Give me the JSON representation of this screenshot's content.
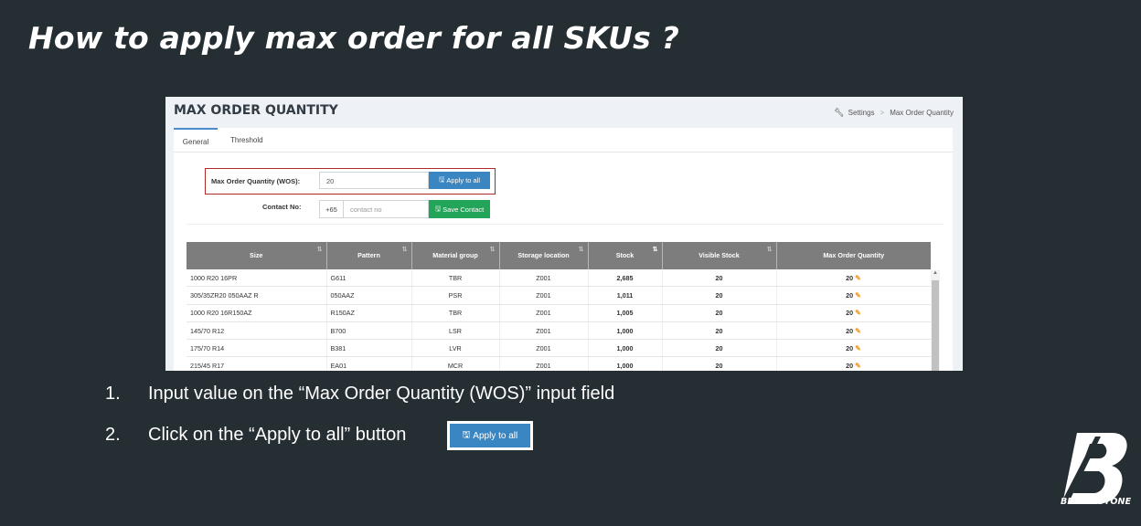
{
  "slide": {
    "title": "How to apply max order for all SKUs ?"
  },
  "screenshot": {
    "page_heading": "MAX ORDER QUANTITY",
    "breadcrumb": {
      "settings": "Settings",
      "current": "Max Order Quantity"
    },
    "tabs": [
      {
        "label": "General",
        "active": true
      },
      {
        "label": "Threshold",
        "active": false
      }
    ],
    "max_order": {
      "label": "Max Order Quantity (WOS):",
      "value": "20",
      "button": "Apply to all"
    },
    "contact": {
      "label": "Contact No:",
      "prefix": "+65",
      "placeholder": "contact no",
      "button": "Save Contact"
    },
    "table": {
      "headers": [
        "Size",
        "Pattern",
        "Material group",
        "Storage location",
        "Stock",
        "Visible Stock",
        "Max Order Quantity"
      ],
      "rows": [
        [
          "1000 R20 16PR",
          "G611",
          "TBR",
          "Z001",
          "2,685",
          "20",
          "20"
        ],
        [
          "305/35ZR20 050AAZ R",
          "050AAZ",
          "PSR",
          "Z001",
          "1,011",
          "20",
          "20"
        ],
        [
          "1000 R20 16R150AZ",
          "R150AZ",
          "TBR",
          "Z001",
          "1,005",
          "20",
          "20"
        ],
        [
          "145/70 R12",
          "B700",
          "LSR",
          "Z001",
          "1,000",
          "20",
          "20"
        ],
        [
          "175/70 R14",
          "B381",
          "LVR",
          "Z001",
          "1,000",
          "20",
          "20"
        ],
        [
          "215/45 R17",
          "EA01",
          "MCR",
          "Z001",
          "1,000",
          "20",
          "20"
        ]
      ]
    }
  },
  "instructions": [
    {
      "num": "1.",
      "text": "Input value on the “Max Order Quantity (WOS)” input field"
    },
    {
      "num": "2.",
      "text": "Click on the “Apply to all” button"
    }
  ],
  "example_button": {
    "label": "Apply to all"
  },
  "logo": {
    "wordmark": "BRIDGESTONE"
  },
  "colors": {
    "background": "#252e33",
    "primary_button": "#3a86c2",
    "success_button": "#22a559",
    "highlight_border": "#b02929"
  },
  "icons": {
    "wrench": "wrench-icon",
    "save": "floppy-disk-icon",
    "edit": "edit-icon",
    "sort": "sort-icon"
  }
}
